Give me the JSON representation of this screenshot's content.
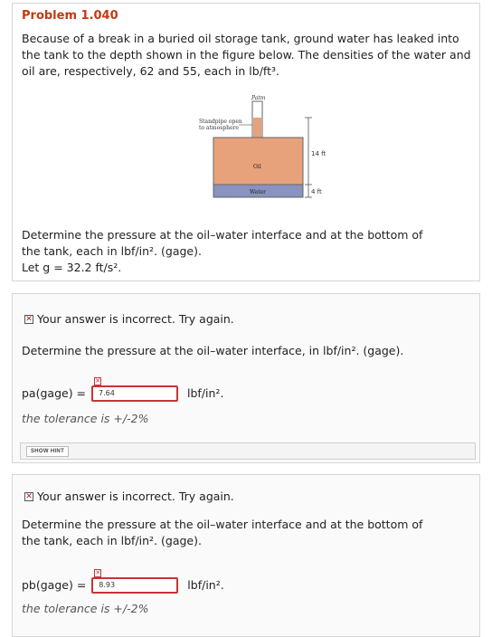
{
  "problem": {
    "title": "Problem 1.040",
    "statement": "Because of a break in a buried oil storage tank, ground water has leaked into the tank to the depth shown in the figure below. The densities of the water and oil are, respectively, 62 and 55, each in lb/ft³.",
    "diagram": {
      "standpipe_label_1": "Standpipe open",
      "standpipe_label_2": "to atmosphere",
      "patm_label": "Patm",
      "oil_label": "Oil",
      "water_label": "Water",
      "dim_14": "14 ft",
      "dim_4": "4 ft",
      "oil_color": "#e7a27c",
      "water_color": "#8893bf"
    },
    "task_line1": "Determine the pressure at the oil–water interface and at the bottom of",
    "task_line2": "the tank, each in lbf/in². (gage).",
    "gravity": "Let g = 32.2 ft/s²."
  },
  "part_a": {
    "status": "Your answer is incorrect.  Try again.",
    "prompt": "Determine the pressure at the oil–water interface, in lbf/in². (gage).",
    "label": "pa(gage) =",
    "value": "7.64",
    "unit": "lbf/in².",
    "tolerance": "the tolerance is +/-2%",
    "hint_button": "SHOW HINT"
  },
  "part_b": {
    "status": "Your answer is incorrect.  Try again.",
    "prompt_line1": "Determine the pressure at the oil–water interface and at the bottom of",
    "prompt_line2": "the tank, each in lbf/in². (gage).",
    "label": "pb(gage) =",
    "value": "8.93",
    "unit": "lbf/in².",
    "tolerance": "the tolerance is +/-2%"
  }
}
